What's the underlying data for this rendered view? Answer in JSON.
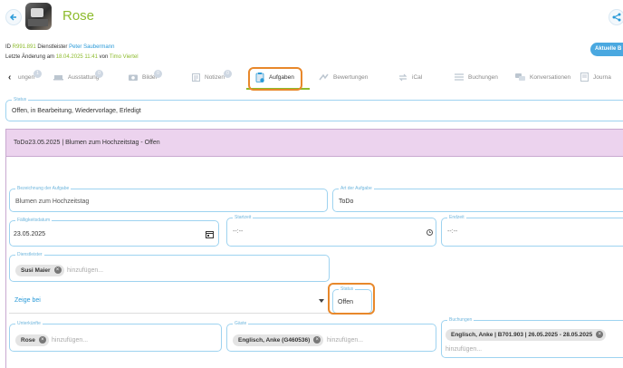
{
  "header": {
    "title": "Rose",
    "back_icon": "arrow-left-icon",
    "share_icon": "share-icon",
    "id_label": "ID",
    "id_value": "R991.891",
    "provider_label": "Dienstleister",
    "provider_value": "Peter Saubermann",
    "changed_label": "Letzte Änderung am",
    "changed_date": "18.04.2025 11:41",
    "changed_by_label": "von",
    "changed_by": "Timo Viertel",
    "current_button": "Aktuelle B"
  },
  "tabs": [
    {
      "label": "ungen",
      "badge": "1",
      "icon": "prev-tab-icon"
    },
    {
      "label": "Ausstattung",
      "badge": "0",
      "icon": "furniture-icon"
    },
    {
      "label": "Bilder",
      "badge": "0",
      "icon": "camera-icon"
    },
    {
      "label": "Notizen",
      "badge": "0",
      "icon": "note-icon"
    },
    {
      "label": "Aufgaben",
      "badge": "",
      "icon": "task-icon",
      "active": true
    },
    {
      "label": "Bewertungen",
      "badge": "",
      "icon": "rating-icon"
    },
    {
      "label": "iCal",
      "badge": "",
      "icon": "sync-icon"
    },
    {
      "label": "Buchungen",
      "badge": "",
      "icon": "list-icon"
    },
    {
      "label": "Konversationen",
      "badge": "",
      "icon": "chat-icon"
    },
    {
      "label": "Journa",
      "badge": "",
      "icon": "journal-icon"
    }
  ],
  "status_filter": {
    "label": "Status",
    "value": "Offen, in Bearbeitung, Wiedervorlage, Erledigt"
  },
  "task": {
    "header": "ToDo23.05.2025 | Blumen zum Hochzeitstag - Offen",
    "title_label": "Bezeichnung der Aufgabe",
    "title_value": "Blumen zum Hochzeitstag",
    "type_label": "Art der Aufgabe",
    "type_value": "ToDo",
    "due_label": "Fälligkeitsdatum",
    "due_value": "23.05.2025",
    "start_label": "Startzeit",
    "start_value": "--:--",
    "end_label": "Endzeit",
    "end_value": "--:--",
    "provider_label": "Dienstleister",
    "provider_chip": "Susi Maier",
    "add_placeholder": "hinzufügen...",
    "show_at_placeholder": "Zeige bei",
    "status_label": "Status",
    "status_value": "Offen",
    "units_label": "Unterkünfte",
    "units_chip": "Rose",
    "guests_label": "Gäste",
    "guests_chip": "Englisch, Anke (G460536)",
    "bookings_label": "Buchungen",
    "bookings_chip": "Englisch, Anke | B701.903 | 26.05.2025 - 28.05.2025"
  },
  "colors": {
    "accent_green": "#8dbb2d",
    "accent_blue": "#2a9ad8",
    "highlight_orange": "#e8882b",
    "task_header_bg": "#ecd3ee"
  }
}
